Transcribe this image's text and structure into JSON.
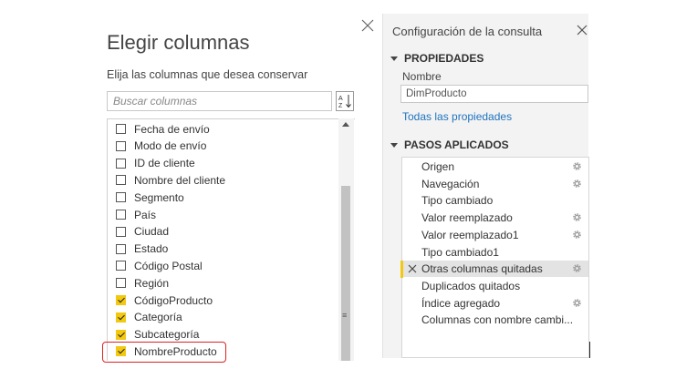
{
  "dialog": {
    "title": "Elegir columnas",
    "subtitle": "Elija las columnas que desea conservar",
    "search_placeholder": "Buscar columnas",
    "columns": [
      {
        "label": "Fecha de envío",
        "checked": false
      },
      {
        "label": "Modo de envío",
        "checked": false
      },
      {
        "label": "ID de cliente",
        "checked": false
      },
      {
        "label": "Nombre del cliente",
        "checked": false
      },
      {
        "label": "Segmento",
        "checked": false
      },
      {
        "label": "País",
        "checked": false
      },
      {
        "label": "Ciudad",
        "checked": false
      },
      {
        "label": "Estado",
        "checked": false
      },
      {
        "label": "Código Postal",
        "checked": false
      },
      {
        "label": "Región",
        "checked": false
      },
      {
        "label": "CódigoProducto",
        "checked": true
      },
      {
        "label": "Categoría",
        "checked": true
      },
      {
        "label": "Subcategoría",
        "checked": true
      },
      {
        "label": "NombreProducto",
        "checked": true
      }
    ]
  },
  "pane": {
    "title": "Configuración de la consulta",
    "properties_header": "PROPIEDADES",
    "name_label": "Nombre",
    "name_value": "DimProducto",
    "all_properties_link": "Todas las propiedades",
    "applied_steps_header": "PASOS APLICADOS",
    "steps": [
      {
        "label": "Origen",
        "gear": true,
        "selected": false
      },
      {
        "label": "Navegación",
        "gear": true,
        "selected": false
      },
      {
        "label": "Tipo cambiado",
        "gear": false,
        "selected": false
      },
      {
        "label": "Valor reemplazado",
        "gear": true,
        "selected": false
      },
      {
        "label": "Valor reemplazado1",
        "gear": true,
        "selected": false
      },
      {
        "label": "Tipo cambiado1",
        "gear": false,
        "selected": false
      },
      {
        "label": "Otras columnas quitadas",
        "gear": true,
        "selected": true
      },
      {
        "label": "Duplicados quitados",
        "gear": false,
        "selected": false
      },
      {
        "label": "Índice agregado",
        "gear": true,
        "selected": false
      },
      {
        "label": "Columnas con nombre cambi...",
        "gear": false,
        "selected": false
      }
    ]
  },
  "colors": {
    "accent_yellow": "#f2c811",
    "link_blue": "#1e73be",
    "highlight_red": "#dd2222"
  },
  "icons": [
    "close-icon",
    "sort-az-icon",
    "checkbox-icon",
    "gear-icon",
    "delete-step-icon",
    "collapse-triangle-icon"
  ]
}
